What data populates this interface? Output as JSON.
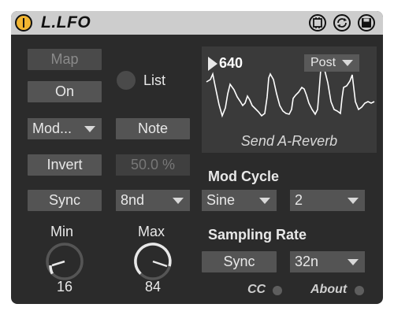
{
  "device": {
    "title": "L.LFO",
    "colors": {
      "power": "#f2b531",
      "background": "#2b2b2b",
      "titlebar": "#cdcdcd"
    }
  },
  "titlebar_icons": [
    "power-icon",
    "hot-swap-icon",
    "map-icon",
    "save-icon"
  ],
  "left": {
    "map_label": "Map",
    "on_label": "On",
    "list_label": "List",
    "mode_select": "Mod...",
    "note_label": "Note",
    "invert_label": "Invert",
    "percent_value": "50.0 %",
    "sync_label": "Sync",
    "rate_select": "8nd",
    "min_label": "Min",
    "max_label": "Max",
    "min_value": "16",
    "max_value": "84"
  },
  "scope": {
    "value": "640",
    "post_select": "Post",
    "send_label": "Send A-Reverb"
  },
  "right": {
    "mod_cycle_label": "Mod Cycle",
    "shape_select": "Sine",
    "cycle_select": "2",
    "sampling_rate_label": "Sampling Rate",
    "sync_label": "Sync",
    "sample_select": "32n",
    "cc_label": "CC",
    "about_label": "About"
  }
}
